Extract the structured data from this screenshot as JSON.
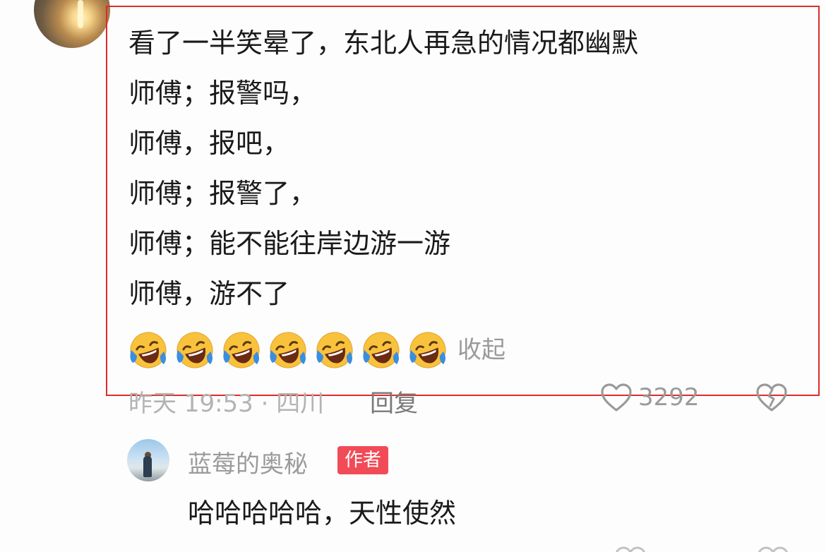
{
  "comment": {
    "author_partial": "◦ ◦◦",
    "lines": [
      "看了一半笑晕了，东北人再急的情况都幽默",
      "师傅；报警吗，",
      "师傅，报吧，",
      "师傅；报警了，",
      "师傅；能不能往岸边游一游",
      "师傅，游不了"
    ],
    "emoji_name": "rolling-on-floor-laughing",
    "emoji_count": 7,
    "collapse_label": "收起",
    "time_location": "昨天 19:53 · 四川",
    "reply_label": "回复",
    "like_count": "3292"
  },
  "reply": {
    "author": "蓝莓的奥秘",
    "badge": "作者",
    "text": "哈哈哈哈哈，天性使然"
  },
  "colors": {
    "highlight_border": "#e02a2a",
    "badge_bg": "#f24b58",
    "emoji_face": "#f9c23c",
    "emoji_tear": "#3b8de0"
  },
  "icons": {
    "like": "heart-outline-icon",
    "dislike": "broken-heart-icon"
  }
}
